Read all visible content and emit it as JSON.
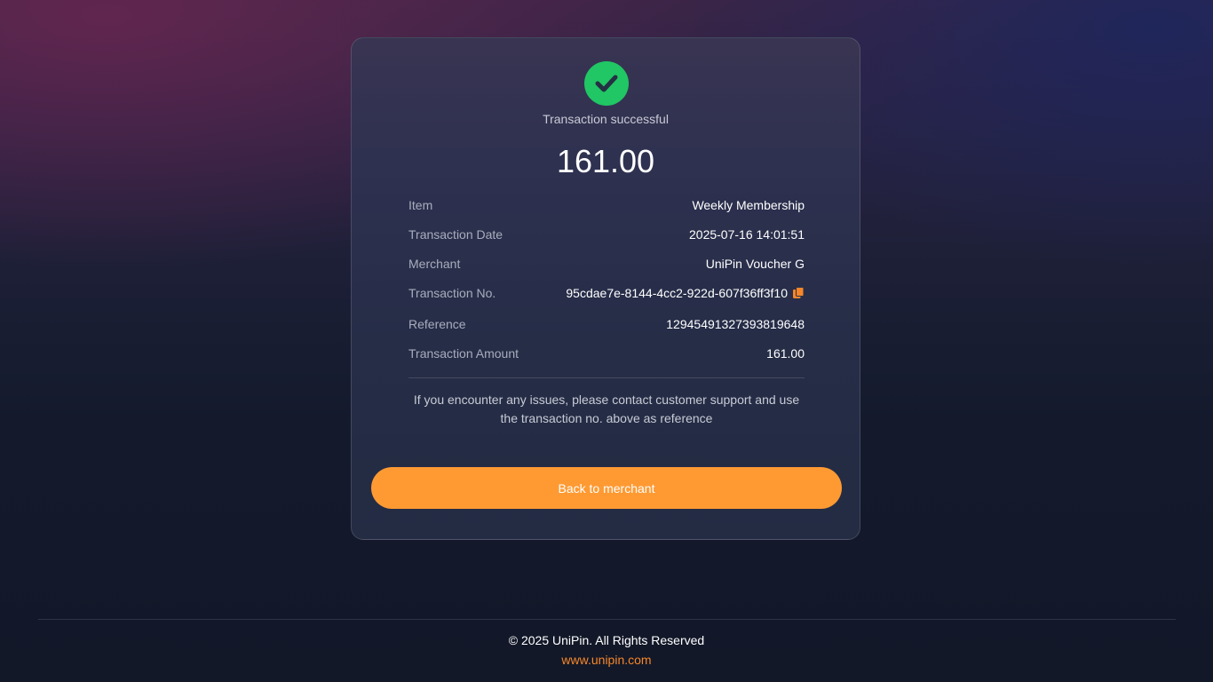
{
  "status": {
    "icon": "check-circle-icon",
    "color": "#20c764",
    "text": "Transaction successful"
  },
  "amount": "161.00",
  "details": [
    {
      "label": "Item",
      "value": "Weekly Membership"
    },
    {
      "label": "Transaction Date",
      "value": "2025-07-16 14:01:51"
    },
    {
      "label": "Merchant",
      "value": "UniPin Voucher G"
    },
    {
      "label": "Transaction No.",
      "value": "95cdae7e-8144-4cc2-922d-607f36ff3f10",
      "icon": "copy-icon"
    },
    {
      "label": "Reference",
      "value": "12945491327393819648"
    },
    {
      "label": "Transaction Amount",
      "value": "161.00"
    }
  ],
  "note": "If you encounter any issues, please contact customer support and use the transaction no. above as reference",
  "back_button": {
    "label": "Back to merchant",
    "color": "#ff9a32"
  },
  "footer": {
    "copyright": "© 2025 UniPin. All Rights Reserved",
    "link": "www.unipin.com",
    "link_color": "#f7862a"
  }
}
